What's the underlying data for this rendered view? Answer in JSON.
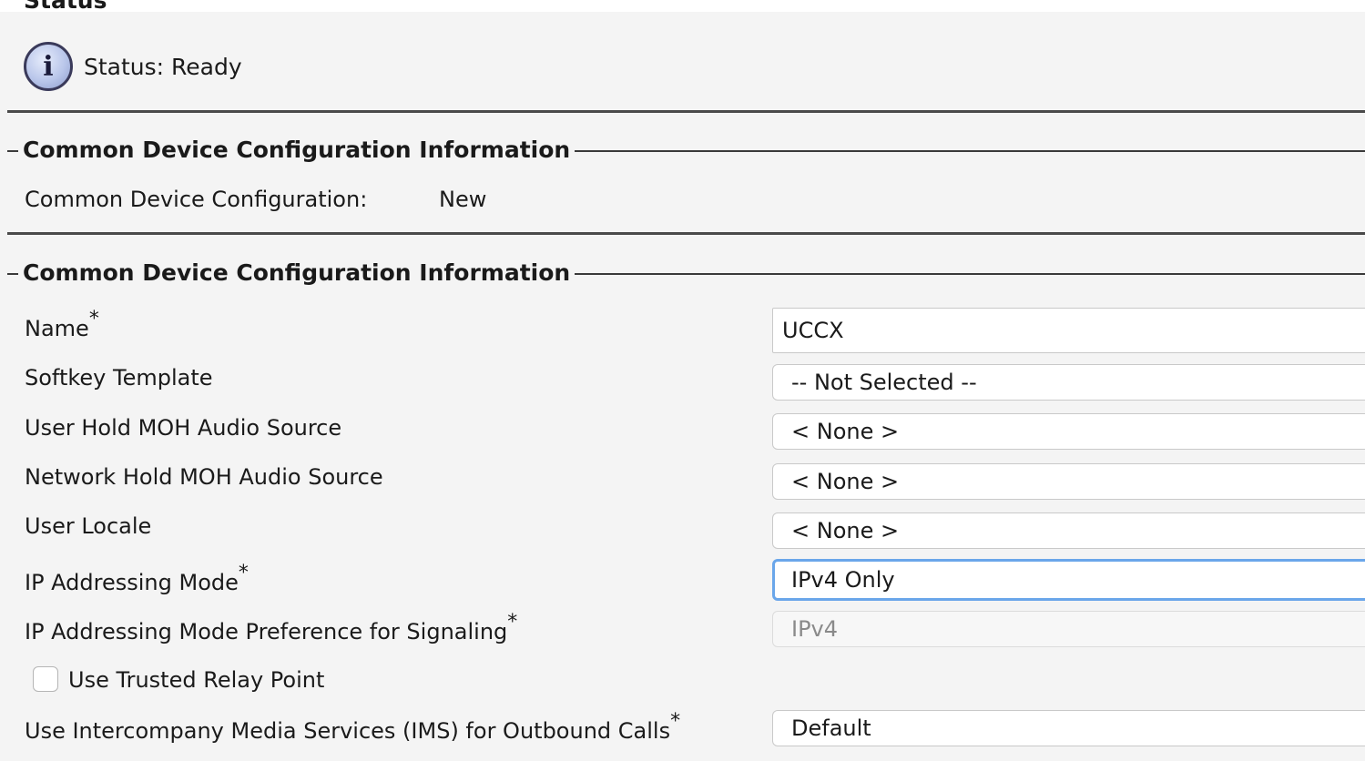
{
  "status_section": {
    "heading": "Status",
    "status_text": "Status: Ready"
  },
  "section1": {
    "legend": "Common Device Configuration Information",
    "label": "Common Device Configuration:",
    "value": "New"
  },
  "section2": {
    "legend": "Common Device Configuration Information",
    "fields": {
      "name": {
        "label": "Name",
        "required": "*",
        "value": "UCCX"
      },
      "softkey": {
        "label": "Softkey Template",
        "value": "-- Not Selected --"
      },
      "user_hold": {
        "label": "User Hold MOH Audio Source",
        "value": "< None >"
      },
      "network_hold": {
        "label": "Network Hold MOH Audio Source",
        "value": "< None >"
      },
      "user_locale": {
        "label": "User Locale",
        "value": "< None >"
      },
      "ip_mode": {
        "label": "IP Addressing Mode",
        "required": "*",
        "value": "IPv4 Only"
      },
      "ip_pref": {
        "label": "IP Addressing Mode Preference for Signaling",
        "required": "*",
        "value": "IPv4"
      },
      "trusted_relay": {
        "label": "Use Trusted Relay Point",
        "checked": false
      },
      "ims": {
        "label": "Use Intercompany Media Services (IMS) for Outbound Calls",
        "required": "*",
        "value": "Default"
      }
    }
  },
  "colors": {
    "background": "#f4f4f4",
    "focus_border": "#6aa6ea",
    "rule": "#4a4a4a"
  }
}
